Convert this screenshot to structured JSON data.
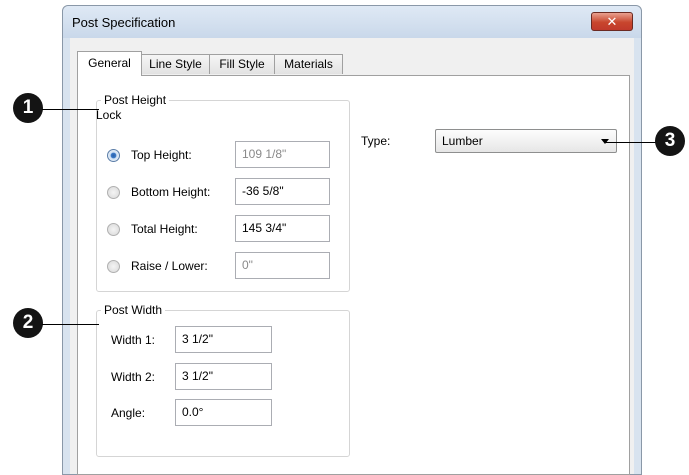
{
  "window": {
    "title": "Post Specification",
    "close_icon": "close-icon",
    "close_glyph": "✕"
  },
  "tabs": [
    {
      "label": "General",
      "active": true
    },
    {
      "label": "Line Style",
      "active": false
    },
    {
      "label": "Fill Style",
      "active": false
    },
    {
      "label": "Materials",
      "active": false
    }
  ],
  "post_height": {
    "group_title": "Post Height",
    "lock_label": "Lock",
    "rows": [
      {
        "label": "Top Height:",
        "value": "109 1/8\"",
        "checked": true,
        "field_disabled": true
      },
      {
        "label": "Bottom Height:",
        "value": "-36 5/8\"",
        "checked": false,
        "field_disabled": false
      },
      {
        "label": "Total Height:",
        "value": "145 3/4\"",
        "checked": false,
        "field_disabled": false
      },
      {
        "label": "Raise / Lower:",
        "value": "0\"",
        "checked": false,
        "field_disabled": true
      }
    ]
  },
  "post_width": {
    "group_title": "Post Width",
    "rows": [
      {
        "label": "Width 1:",
        "value": "3 1/2\""
      },
      {
        "label": "Width 2:",
        "value": "3 1/2\""
      },
      {
        "label": "Angle:",
        "value": "0.0°"
      }
    ]
  },
  "type": {
    "label": "Type:",
    "selected": "Lumber"
  },
  "callouts": [
    "1",
    "2",
    "3"
  ],
  "colors": {
    "callout_bg": "#141414",
    "close_button": "#c8462d",
    "panel_bg": "#ffffff",
    "frame_bg": "#d8e3ef"
  }
}
